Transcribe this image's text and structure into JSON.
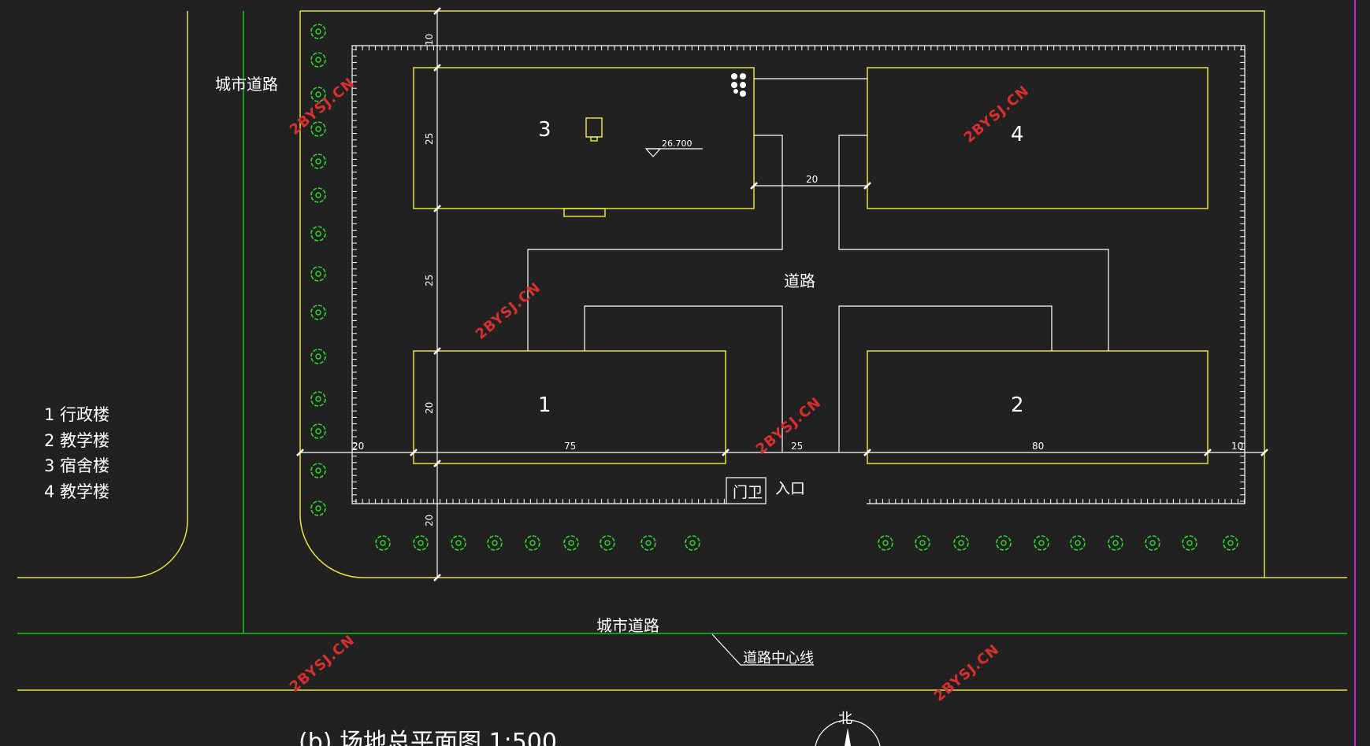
{
  "labels": {
    "city_road_left": "城市道路",
    "city_road_bottom": "城市道路",
    "road_center": "道路中心线",
    "road": "道路",
    "gate": "门卫",
    "entrance": "入口",
    "north": "北",
    "elevation": "26.700",
    "title": "(b) 场地总平面图 1:500"
  },
  "buildings": [
    "3",
    "4",
    "1",
    "2"
  ],
  "legend": [
    "1 行政楼",
    "2 教学楼",
    "3 宿舍楼",
    "4 教学楼"
  ],
  "dimensions": {
    "vertical": [
      "10",
      "25",
      "25",
      "20",
      "20"
    ],
    "horizontal": [
      "20",
      "75",
      "25",
      "80",
      "10"
    ],
    "between_3_4": "20"
  },
  "watermark": "2BYSJ.CN",
  "colors": {
    "background": "#212121",
    "building_outline": "#e6e33c",
    "road_line": "#19c519",
    "tree": "#2fd82f",
    "dimension": "#ffffff",
    "watermark": "#d62f2f"
  }
}
